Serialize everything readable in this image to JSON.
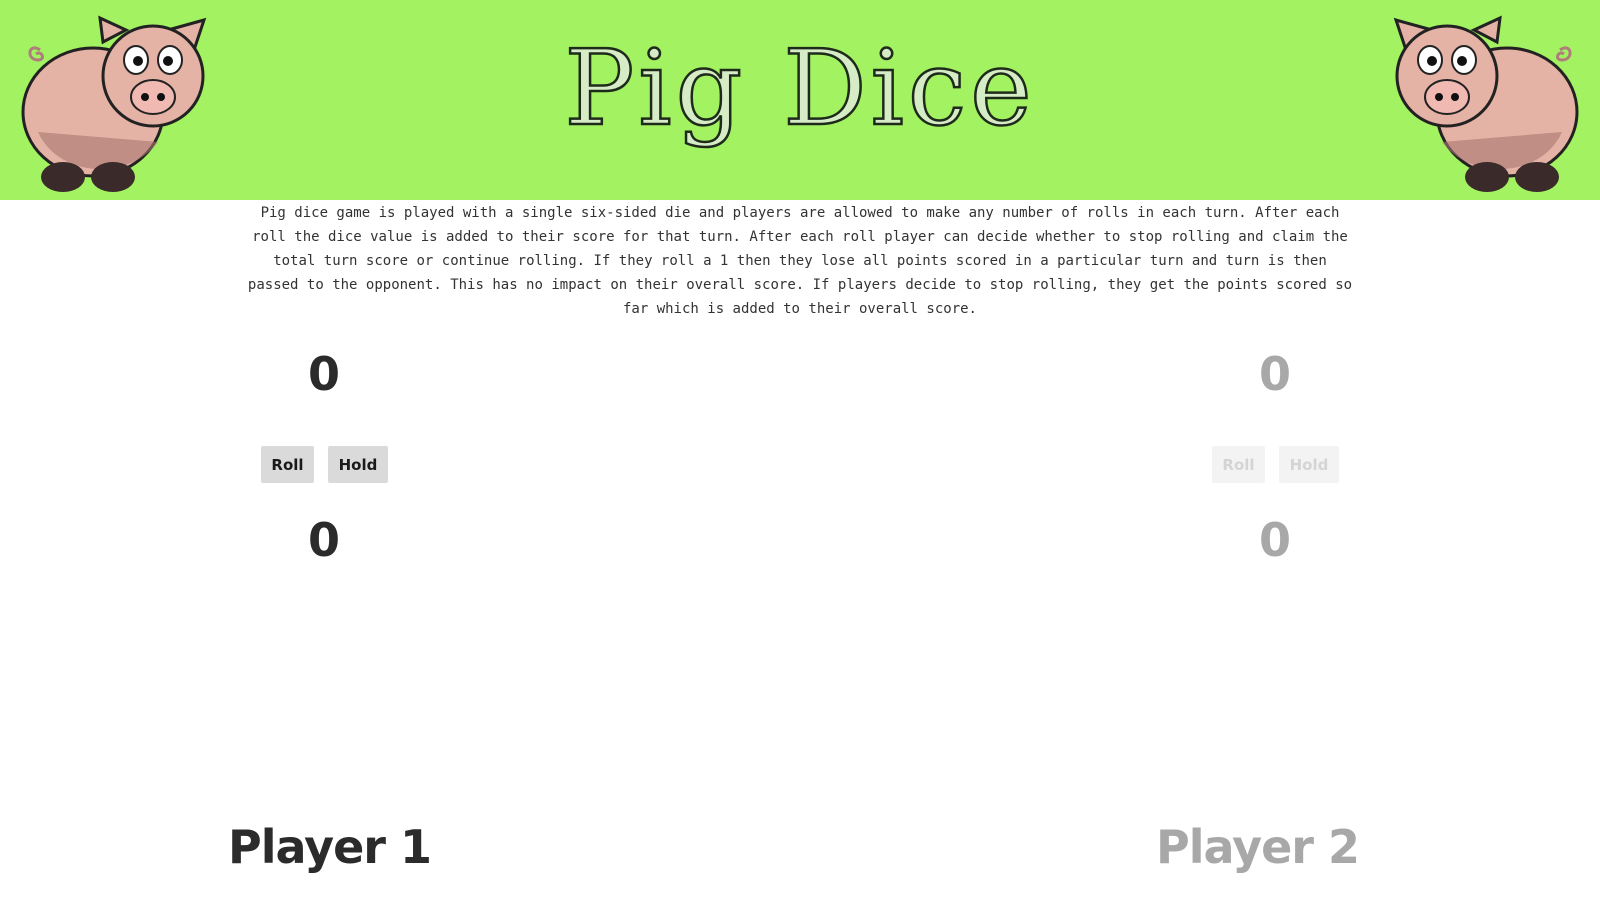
{
  "header": {
    "title": "Pig Dice",
    "bg_color": "#a3f261",
    "left_icon": "pig-icon",
    "right_icon": "pig-icon"
  },
  "rules_text": "Pig dice game is played with a single six-sided die and players are allowed to make any number of rolls in each turn. After each roll the dice value is added to their score for that turn. After each roll player can decide whether to stop rolling and claim the total turn score or continue rolling. If they roll a 1 then they lose all points scored in a particular turn and turn is then passed to the opponent. This has no impact on their overall score. If players decide to stop rolling, they get the points scored so far which is added to their overall score.",
  "players": [
    {
      "name": "Player 1",
      "total_score": "0",
      "turn_score": "0",
      "roll_label": "Roll",
      "hold_label": "Hold",
      "active": true
    },
    {
      "name": "Player 2",
      "total_score": "0",
      "turn_score": "0",
      "roll_label": "Roll",
      "hold_label": "Hold",
      "active": false
    }
  ],
  "colors": {
    "active_text": "#2b2b2b",
    "inactive_text": "#a8a8a8",
    "button_active": "#dadada",
    "button_inactive": "#f3f3f3"
  }
}
